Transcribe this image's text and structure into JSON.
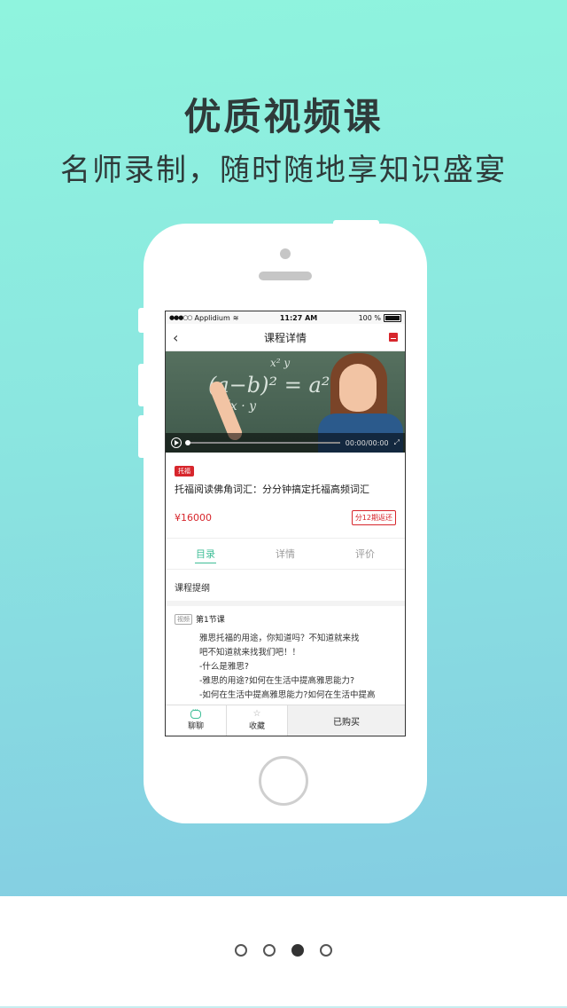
{
  "hero": {
    "headline": "优质视频课",
    "subline": "名师录制，随时随地享知识盛宴"
  },
  "status_bar": {
    "carrier": "Applidium",
    "time": "11:27 AM",
    "battery": "100 %"
  },
  "nav": {
    "title": "课程详情"
  },
  "video": {
    "time": "00:00/00:00",
    "progress": 0
  },
  "course": {
    "tag": "托福",
    "title": "托福阅读佛角词汇：分分钟搞定托福高频词汇",
    "price": "¥16000",
    "installment": "分12期返还"
  },
  "tabs": [
    {
      "label": "目录"
    },
    {
      "label": "详情"
    },
    {
      "label": "评价"
    }
  ],
  "outline": {
    "label": "课程提纲"
  },
  "lesson": {
    "tag": "视频",
    "title": "第1节课",
    "lines": [
      "雅思托福的用途，你知道吗？不知道就来找",
      "吧不知道就来找我们吧！！",
      "-什么是雅思?",
      "-雅思的用途?如何在生活中提高雅思能力?",
      "-如何在生活中提高雅思能力?如何在生活中提高"
    ]
  },
  "bottom_bar": {
    "chat": "聊聊",
    "favorite": "收藏",
    "purchased": "已购买"
  },
  "pager": {
    "count": 4,
    "active": 3
  },
  "colors": {
    "accent_green": "#3fbe97",
    "accent_red": "#d7262c"
  }
}
